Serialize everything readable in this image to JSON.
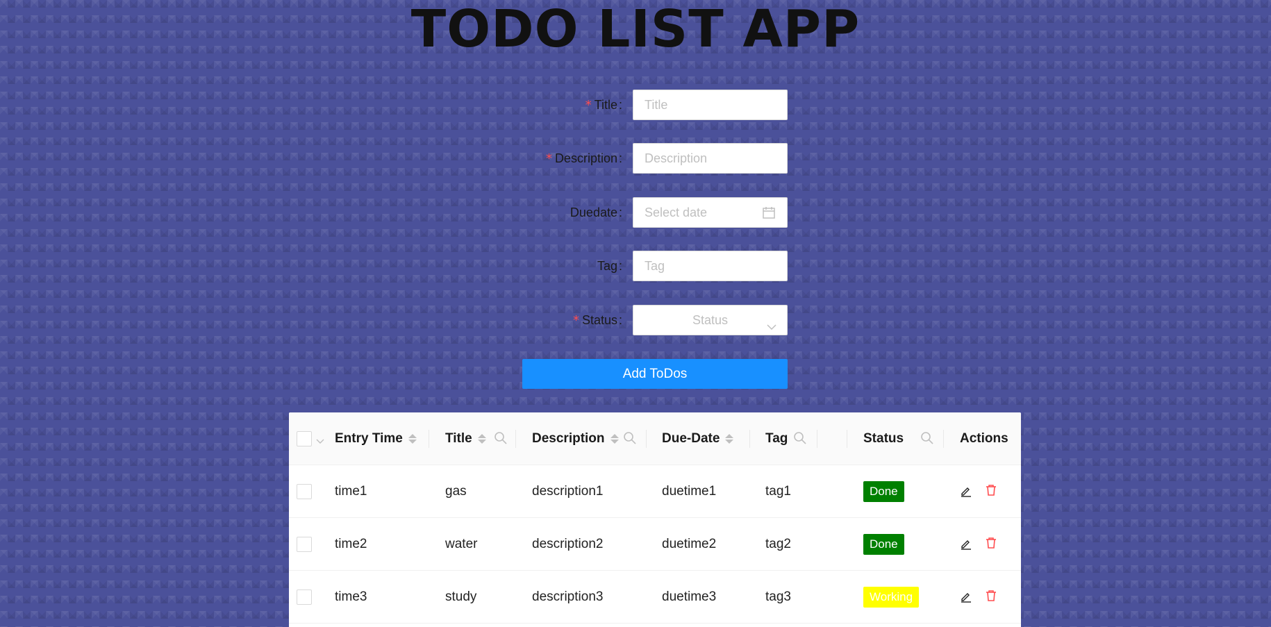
{
  "app": {
    "title": "TODO LIST APP"
  },
  "form": {
    "title": {
      "label": "Title",
      "placeholder": "Title",
      "required": true
    },
    "description": {
      "label": "Description",
      "placeholder": "Description",
      "required": true
    },
    "duedate": {
      "label": "Duedate",
      "placeholder": "Select date",
      "required": false
    },
    "tag": {
      "label": "Tag",
      "placeholder": "Tag",
      "required": false
    },
    "status": {
      "label": "Status",
      "placeholder": "Status",
      "required": true
    },
    "submit_label": "Add ToDos",
    "required_mark": "*",
    "colon": ":"
  },
  "table": {
    "columns": {
      "entry_time": "Entry Time",
      "title": "Title",
      "description": "Description",
      "due_date": "Due-Date",
      "tag": "Tag",
      "status": "Status",
      "actions": "Actions"
    },
    "rows": [
      {
        "entry_time": "time1",
        "title": "gas",
        "description": "description1",
        "due_date": "duetime1",
        "tag": "tag1",
        "status": "Done"
      },
      {
        "entry_time": "time2",
        "title": "water",
        "description": "description2",
        "due_date": "duetime2",
        "tag": "tag2",
        "status": "Done"
      },
      {
        "entry_time": "time3",
        "title": "study",
        "description": "description3",
        "due_date": "duetime3",
        "tag": "tag3",
        "status": "Working"
      }
    ]
  },
  "colors": {
    "background": "#4b519a",
    "primary": "#1890ff",
    "required": "#ff4d4f",
    "status_done_bg": "#008000",
    "status_done_fg": "#ffffff",
    "status_working_bg": "#ffff00",
    "status_working_fg": "#ffffff",
    "delete_icon": "#ff4d4f"
  },
  "icons": {
    "calendar": "calendar-icon",
    "dropdown": "chevron-down-icon",
    "sort": "sort-icon",
    "search": "search-icon",
    "edit": "edit-icon",
    "delete": "delete-icon"
  }
}
